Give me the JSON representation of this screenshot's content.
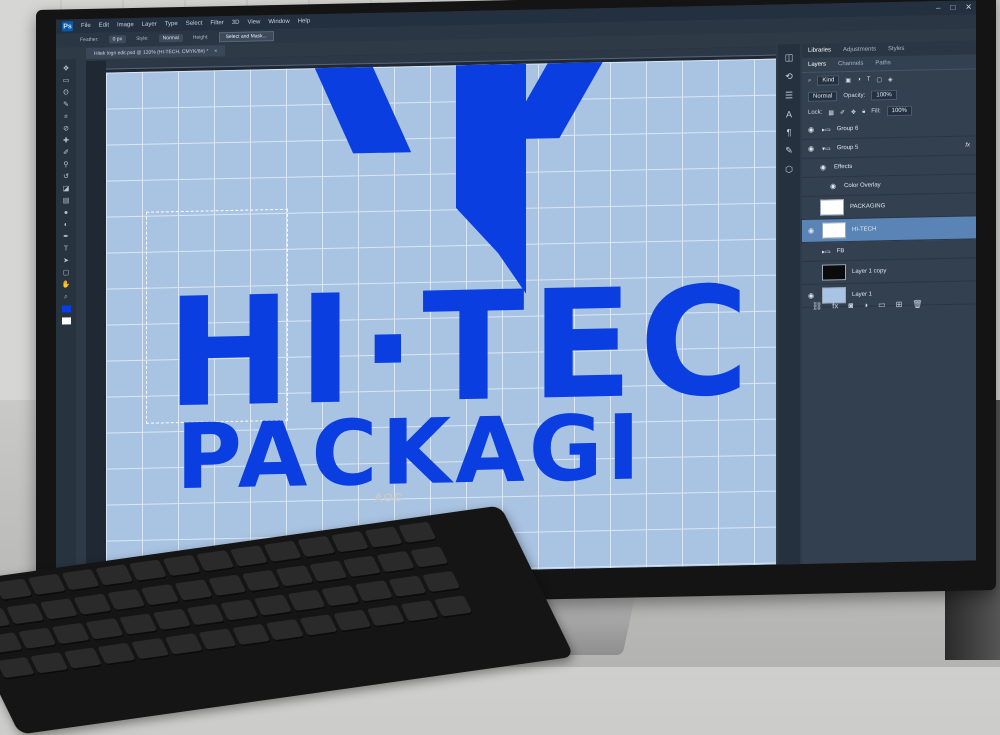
{
  "monitor": {
    "brand": "AOC"
  },
  "menubar": {
    "app_icon": "Ps",
    "items": [
      "File",
      "Edit",
      "Image",
      "Layer",
      "Type",
      "Select",
      "Filter",
      "3D",
      "View",
      "Window",
      "Help"
    ],
    "window_controls": [
      "–",
      "□",
      "✕"
    ]
  },
  "options_bar": {
    "feather_label": "Feather:",
    "feather_value": "0 px",
    "style_label": "Style:",
    "style_value": "Normal",
    "height_label": "Height:",
    "select_mask_button": "Select and Mask..."
  },
  "document_tab": {
    "title": "Hitek logo edit.psd @ 120% (HI-TECH, CMYK/8#) *",
    "close": "×"
  },
  "canvas": {
    "logo_line1": "HI·TEC",
    "logo_line2": "PACKAGI"
  },
  "panel": {
    "top_tabs": [
      "Libraries",
      "Adjustments",
      "Styles"
    ],
    "sub_tabs": [
      "Layers",
      "Channels",
      "Paths"
    ],
    "filter_label": "Kind",
    "blend_mode": "Normal",
    "opacity_label": "Opacity:",
    "opacity_value": "100%",
    "lock_label": "Lock:",
    "fill_label": "Fill:",
    "fill_value": "100%",
    "layers": [
      {
        "name": "Group 6",
        "type": "group"
      },
      {
        "name": "Group 5",
        "type": "group",
        "fx": "fx"
      },
      {
        "name": "Effects",
        "type": "effects"
      },
      {
        "name": "Color Overlay",
        "type": "effect"
      },
      {
        "name": "PACKAGING",
        "type": "text"
      },
      {
        "name": "HI-TECH",
        "type": "text",
        "selected": true
      },
      {
        "name": "FB",
        "type": "group"
      },
      {
        "name": "Layer 1 copy",
        "type": "pixel",
        "thumb": "black"
      },
      {
        "name": "Layer 1",
        "type": "pixel",
        "thumb": "blue"
      }
    ]
  },
  "colors": {
    "logo_blue": "#0a3ee0",
    "canvas_bg": "#a9c3e2",
    "selected_layer": "#5b84b6"
  }
}
